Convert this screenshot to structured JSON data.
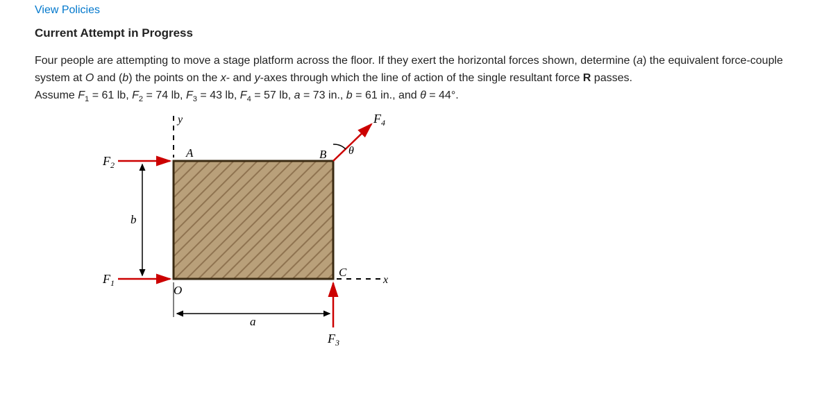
{
  "link": {
    "viewPolicies": "View Policies"
  },
  "status": {
    "attempt": "Current Attempt in Progress"
  },
  "problem": {
    "text1": "Four people are attempting to move a stage platform across the floor. If they exert the horizontal forces shown, determine (",
    "partA": "a",
    "text2": ") the equivalent force-couple system at ",
    "O": "O",
    "text3": " and (",
    "partB": "b",
    "text4": ") the points on the ",
    "xax": "x",
    "text5": "- and ",
    "yax": "y",
    "text6": "-axes through which the line of action of the single resultant force ",
    "R": "R",
    "text7": " passes."
  },
  "given": {
    "assume": "Assume ",
    "F1lbl": "F",
    "F1sub": "1",
    "eq": " = ",
    "F1": "61",
    "lb": " lb, ",
    "F2lbl": "F",
    "F2sub": "2",
    "F2": "74",
    "F3lbl": "F",
    "F3sub": "3",
    "F3": "43",
    "F4lbl": "F",
    "F4sub": "4",
    "F4": "57",
    "lbcomma": " lb, ",
    "albl": "a",
    "a": "73",
    "inunit": " in., ",
    "blbl": "b",
    "b": "61",
    "inand": " in., and ",
    "thetalbl": "θ",
    "thetaeq": "  =  ",
    "theta": "44",
    "deg": "°."
  },
  "diagram": {
    "y": "y",
    "A": "A",
    "B": "B",
    "theta": "θ",
    "F4": "F",
    "F4s": "4",
    "F2": "F",
    "F2s": "2",
    "b": "b",
    "F1": "F",
    "F1s": "1",
    "O": "O",
    "C": "C",
    "x": "x",
    "a": "a",
    "F3": "F",
    "F3s": "3"
  }
}
